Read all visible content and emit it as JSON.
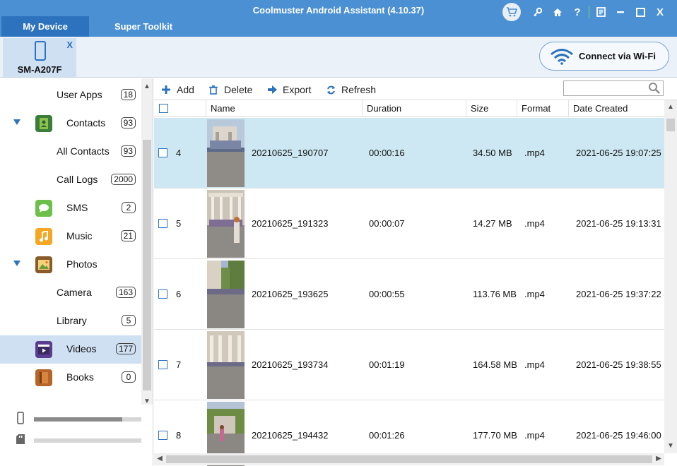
{
  "app": {
    "title": "Coolmuster Android Assistant (4.10.37)",
    "tabs": [
      "My Device",
      "Super Toolkit"
    ],
    "window_icons": [
      "cart-icon",
      "key-icon",
      "home-icon",
      "help-icon",
      "feedback-icon",
      "minimize-icon",
      "maximize-icon",
      "close-icon"
    ],
    "help_glyph": "?",
    "close_glyph": "X"
  },
  "device": {
    "name": "SM-A207F",
    "close_glyph": "X",
    "wifi_label": "Connect via Wi-Fi"
  },
  "sidebar": {
    "items": [
      {
        "label": "User Apps",
        "count": "18",
        "level": "sub"
      },
      {
        "label": "Contacts",
        "count": "93",
        "level": "cat",
        "icon": "contacts-icon",
        "expanded": true
      },
      {
        "label": "All Contacts",
        "count": "93",
        "level": "sub"
      },
      {
        "label": "Call Logs",
        "count": "2000",
        "level": "sub"
      },
      {
        "label": "SMS",
        "count": "2",
        "level": "cat",
        "icon": "sms-icon"
      },
      {
        "label": "Music",
        "count": "21",
        "level": "cat",
        "icon": "music-icon"
      },
      {
        "label": "Photos",
        "count": "",
        "level": "cat",
        "icon": "photos-icon",
        "expanded": true
      },
      {
        "label": "Camera",
        "count": "163",
        "level": "sub"
      },
      {
        "label": "Library",
        "count": "5",
        "level": "sub"
      },
      {
        "label": "Videos",
        "count": "177",
        "level": "cat",
        "icon": "videos-icon",
        "active": true
      },
      {
        "label": "Books",
        "count": "0",
        "level": "cat",
        "icon": "books-icon"
      }
    ],
    "storage": {
      "phone_used": 0.82,
      "sd_used": 0.0
    }
  },
  "toolbar": {
    "add": "Add",
    "delete": "Delete",
    "export": "Export",
    "refresh": "Refresh",
    "search_placeholder": ""
  },
  "table": {
    "columns": [
      "Name",
      "Duration",
      "Size",
      "Format",
      "Date Created"
    ],
    "rows": [
      {
        "index": "4",
        "name": "20210625_190707",
        "duration": "00:00:16",
        "size": "34.50 MB",
        "format": ".mp4",
        "date": "2021-06-25 19:07:25",
        "selected": true
      },
      {
        "index": "5",
        "name": "20210625_191323",
        "duration": "00:00:07",
        "size": "14.27 MB",
        "format": ".mp4",
        "date": "2021-06-25 19:13:31"
      },
      {
        "index": "6",
        "name": "20210625_193625",
        "duration": "00:00:55",
        "size": "113.76 MB",
        "format": ".mp4",
        "date": "2021-06-25 19:37:22"
      },
      {
        "index": "7",
        "name": "20210625_193734",
        "duration": "00:01:19",
        "size": "164.58 MB",
        "format": ".mp4",
        "date": "2021-06-25 19:38:55"
      },
      {
        "index": "8",
        "name": "20210625_194432",
        "duration": "00:01:26",
        "size": "177.70 MB",
        "format": ".mp4",
        "date": "2021-06-25 19:46:00"
      }
    ]
  },
  "colors": {
    "accent": "#4a90d2",
    "tab_active": "#2d72bd",
    "selected_row": "#cde8f2",
    "sidebar_active": "#cfe0f2"
  }
}
